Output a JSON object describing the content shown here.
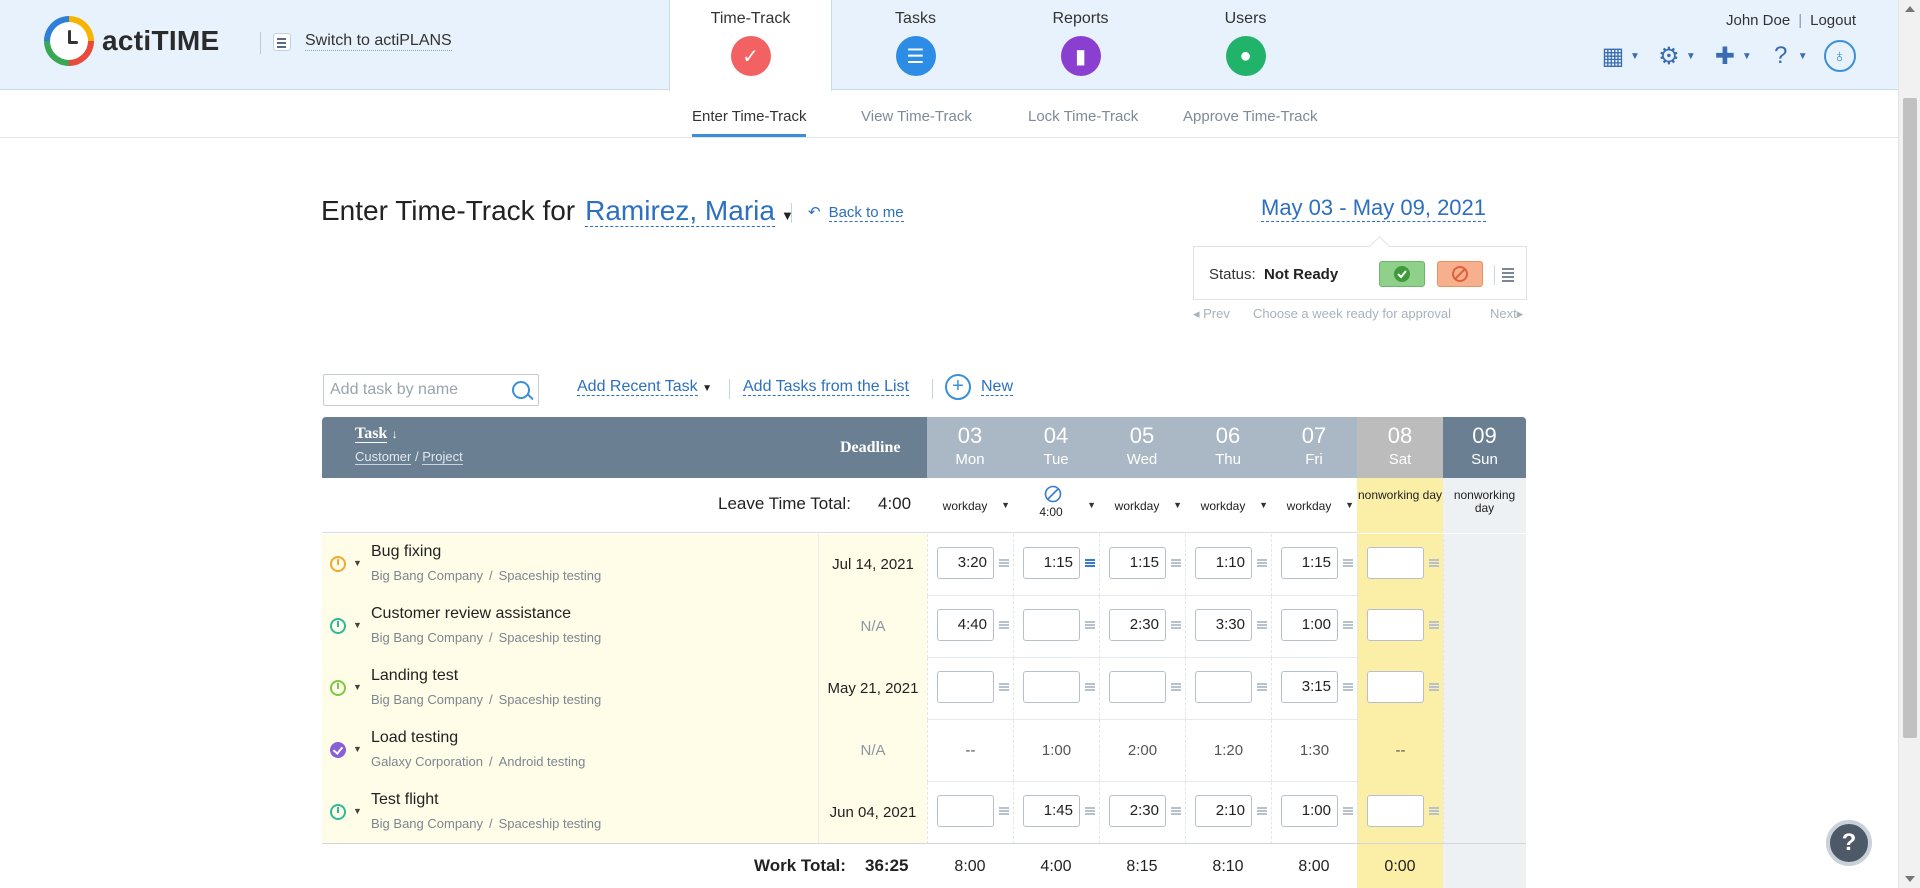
{
  "app": {
    "name": "actiTIME",
    "switch_label": "Switch to actiPLANS"
  },
  "modules": [
    {
      "label": "Time-Track",
      "icon": "time-track-icon",
      "color": "#f26262"
    },
    {
      "label": "Tasks",
      "icon": "tasks-icon",
      "color": "#2d8ce6"
    },
    {
      "label": "Reports",
      "icon": "reports-icon",
      "color": "#8a3fd1"
    },
    {
      "label": "Users",
      "icon": "users-icon",
      "color": "#22b36a"
    }
  ],
  "user": {
    "name": "John Doe",
    "logout": "Logout"
  },
  "subtabs": [
    "Enter Time-Track",
    "View Time-Track",
    "Lock Time-Track",
    "Approve Time-Track"
  ],
  "page": {
    "title_prefix": "Enter Time-Track for",
    "user_selected": "Ramirez, Maria",
    "back_label": "Back to me",
    "date_range": "May 03 - May 09, 2021"
  },
  "status": {
    "label": "Status:",
    "value": "Not Ready",
    "prev": "Prev",
    "hint": "Choose a week ready for approval",
    "next": "Next"
  },
  "add_task": {
    "search_placeholder": "Add task by name",
    "recent": "Add Recent Task",
    "from_list": "Add Tasks from the List",
    "new": "New"
  },
  "grid": {
    "task_header": "Task",
    "customer_header": "Customer",
    "project_header": "Project",
    "separator": "/",
    "deadline_header": "Deadline",
    "days": [
      {
        "num": "03",
        "dow": "Mon",
        "type": "workday"
      },
      {
        "num": "04",
        "dow": "Tue",
        "type": "4:00"
      },
      {
        "num": "05",
        "dow": "Wed",
        "type": "workday"
      },
      {
        "num": "06",
        "dow": "Thu",
        "type": "workday"
      },
      {
        "num": "07",
        "dow": "Fri",
        "type": "workday"
      },
      {
        "num": "08",
        "dow": "Sat",
        "type": "nonworking day"
      },
      {
        "num": "09",
        "dow": "Sun",
        "type": "nonworking day"
      }
    ],
    "leave_label": "Leave Time Total:",
    "leave_value": "4:00",
    "rows": [
      {
        "name": "Bug fixing",
        "customer": "Big Bang Company",
        "project": "Spaceship testing",
        "deadline": "Jul 14, 2021",
        "status_color": "#f0a830",
        "times": [
          "3:20",
          "1:15",
          "1:15",
          "1:10",
          "1:15",
          ""
        ]
      },
      {
        "name": "Customer review assistance",
        "customer": "Big Bang Company",
        "project": "Spaceship testing",
        "deadline": "N/A",
        "status_color": "#2fb89a",
        "times": [
          "4:40",
          "",
          "2:30",
          "3:30",
          "1:00",
          ""
        ]
      },
      {
        "name": "Landing test",
        "customer": "Big Bang Company",
        "project": "Spaceship testing",
        "deadline": "May 21, 2021",
        "status_color": "#7ac943",
        "times": [
          "",
          "",
          "",
          "",
          "3:15",
          ""
        ]
      },
      {
        "name": "Load testing",
        "customer": "Galaxy Corporation",
        "project": "Android testing",
        "deadline": "N/A",
        "status_color": "#8a5fd6",
        "times": [
          "--",
          "1:00",
          "2:00",
          "1:20",
          "1:30",
          "--"
        ]
      },
      {
        "name": "Test flight",
        "customer": "Big Bang Company",
        "project": "Spaceship testing",
        "deadline": "Jun 04, 2021",
        "status_color": "#2fb89a",
        "times": [
          "",
          "1:45",
          "2:30",
          "2:10",
          "1:00",
          ""
        ]
      }
    ],
    "work_total_label": "Work Total:",
    "work_total_value": "36:25",
    "day_totals": [
      "8:00",
      "4:00",
      "8:15",
      "8:10",
      "8:00",
      "0:00",
      ""
    ]
  },
  "help_label": "?"
}
